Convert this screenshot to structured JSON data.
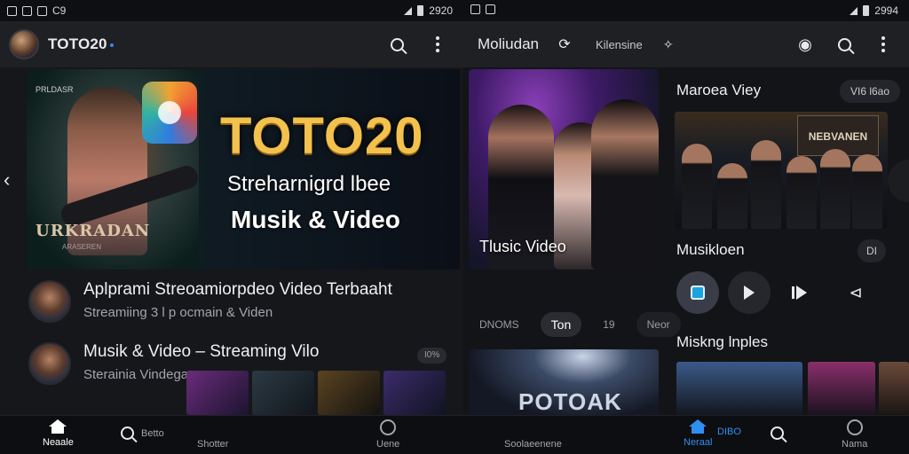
{
  "left": {
    "status": {
      "time": "2920",
      "left_text": "C9"
    },
    "app": {
      "title": "TOTO20"
    },
    "hero": {
      "brand": "TOTO20",
      "line1": "Streharnigrd lbee",
      "line2": "Musik & Video",
      "photo_caption": "URKRADAN",
      "photo_top": "PRLDASR",
      "photo_sub": "ARASEREN"
    },
    "feed": [
      {
        "title": "Aplprami Streoamiorpdeo Video Terbaaht",
        "subtitle": "Streamiing 3 l p ocmain & Viden"
      },
      {
        "title": "Musik & Video – Streaming Vilo",
        "subtitle": "Sterainia Vindegann",
        "badge": "I0%"
      }
    ],
    "bottom_nav": [
      {
        "label": "Neaale",
        "icon": "home-icon"
      },
      {
        "label": "Betto",
        "icon": "search-icon"
      },
      {
        "label": "Shotter",
        "icon": ""
      },
      {
        "label": "Uene",
        "icon": "circle-icon"
      }
    ]
  },
  "right": {
    "status": {
      "time": "2994"
    },
    "nav": {
      "title": "Moliudan",
      "secondary": "Kilensine"
    },
    "card": {
      "caption": "Tlusic Video"
    },
    "section1": {
      "title": "Maroea Viey",
      "pill": "VI6 l6ao"
    },
    "media_sign": "NEBVANEN",
    "section2": {
      "title": "Musikloen",
      "pill": "DI"
    },
    "tabs": [
      {
        "label": "DNOMS",
        "active": false
      },
      {
        "label": "Ton",
        "active": true
      },
      {
        "label": "19",
        "active": false
      },
      {
        "label": "Neor",
        "active": false
      }
    ],
    "poster_title": "POTOAK",
    "section3": {
      "title": "Miskng lnples"
    },
    "bottom_nav": [
      {
        "label": "Soolaeenene",
        "icon": ""
      },
      {
        "label": "Neraal",
        "icon": "home-icon"
      },
      {
        "label": "DIBO",
        "icon": ""
      },
      {
        "label": "Nama",
        "icon": "gear-icon"
      }
    ]
  },
  "colors": {
    "accent": "#2f8ff0",
    "gold": "#f3c14d",
    "background": "#16171b"
  }
}
